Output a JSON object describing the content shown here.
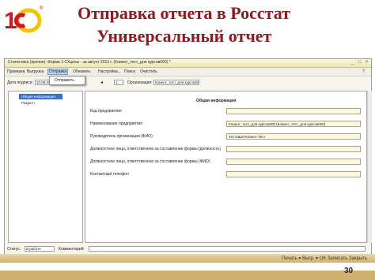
{
  "slide": {
    "title_line1": "Отправка отчета в Росстат",
    "title_line2": "Универсальный отчет",
    "page_number": "30",
    "logo_tm": "®"
  },
  "colors": {
    "title": "#8e1b22",
    "logo_red": "#d2141e",
    "logo_yellow": "#f2c400",
    "highlight": "#fdf9e0",
    "selection": "#3a6fc4"
  },
  "window": {
    "title": "Статистика (прочие): Форма 1-СХцены - за август 2013 г. (Клиент_тест_для курсов000) *",
    "buttons": {
      "minimize": "_",
      "maximize": "□",
      "close": "×"
    }
  },
  "toolbar": {
    "items": [
      "Проверка",
      "Выгрузка",
      "Отправка",
      "Обновить",
      "Настройка...",
      "Поиск",
      "Очистить"
    ],
    "help": "?"
  },
  "dropdown": {
    "item": "Отправить"
  },
  "header_fields": {
    "date_label": "Дата подписи:",
    "date_value": "10.09.2013",
    "period_label": "Период:",
    "period_arrow": "◄",
    "page_label": "1",
    "org_label": "Организация:",
    "org_value": "Клиент_тест_для курсов000"
  },
  "tree": {
    "items": [
      "Общая информация",
      "Раздел I"
    ]
  },
  "form": {
    "section_title": "Общая информация",
    "rows": [
      {
        "label": "Код предприятия",
        "value": ""
      },
      {
        "label": "Наименование предприятия",
        "value": "Клиент_тест_для курсов000 (Клиент_тест_для курсов000)"
      },
      {
        "label": "Руководитель организации (ФИО)",
        "value": "Тестовый Клиент Тест"
      },
      {
        "label": "Должностное лицо, ответственное за составление формы (должность)",
        "value": ""
      },
      {
        "label": "Должностное лицо, ответственное за составление формы (ФИО)",
        "value": ""
      },
      {
        "label": "Контактный телефон",
        "value": ""
      }
    ]
  },
  "status_bar": {
    "status_label": "Статус:",
    "status_value": "В работе",
    "comment_label": "Комментарий:",
    "comment_value": ""
  },
  "bottom_nav": {
    "label": "Печать ▾  Выгр. ▾  ОК  Записать  Закрыть"
  }
}
